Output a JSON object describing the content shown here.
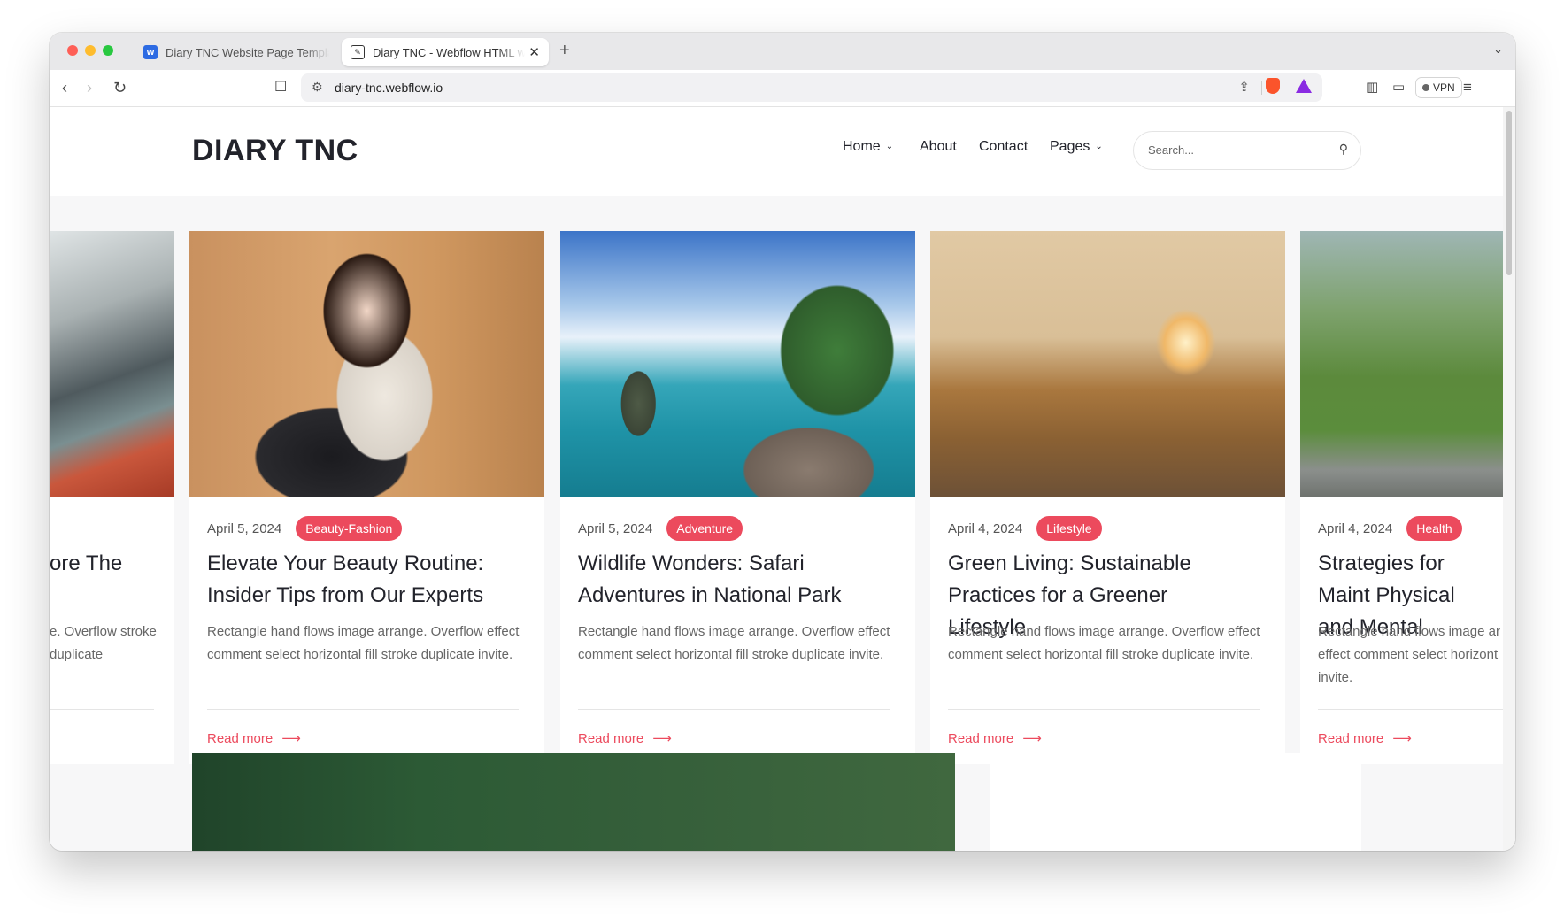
{
  "browser": {
    "tabs": [
      {
        "title": "Diary TNC Website Page Template",
        "active": false
      },
      {
        "title": "Diary TNC - Webflow HTML website template",
        "active": true
      }
    ],
    "new_tab_symbol": "+",
    "close_symbol": "✕",
    "url": "diary-tnc.webflow.io",
    "vpn_label": "VPN"
  },
  "site": {
    "logo": "DIARY TNC",
    "nav": [
      {
        "label": "Home",
        "has_dropdown": true
      },
      {
        "label": "About",
        "has_dropdown": false
      },
      {
        "label": "Contact",
        "has_dropdown": false
      },
      {
        "label": "Pages",
        "has_dropdown": true
      }
    ],
    "search_placeholder": "Search..."
  },
  "cards": [
    {
      "date": "",
      "tag": "",
      "title": "ore The",
      "excerpt": "e. Overflow stroke duplicate",
      "read_more": ""
    },
    {
      "date": "April 5, 2024",
      "tag": "Beauty-Fashion",
      "title": "Elevate Your Beauty Routine: Insider Tips from Our Experts",
      "excerpt": "Rectangle hand flows image arrange. Overflow effect comment select horizontal fill stroke duplicate invite.",
      "read_more": "Read more"
    },
    {
      "date": "April 5, 2024",
      "tag": "Adventure",
      "title": "Wildlife Wonders: Safari Adventures in National Park",
      "excerpt": "Rectangle hand flows image arrange. Overflow effect comment select horizontal fill stroke duplicate invite.",
      "read_more": "Read more"
    },
    {
      "date": "April 4, 2024",
      "tag": "Lifestyle",
      "title": "Green Living: Sustainable Practices for a Greener Lifestyle",
      "excerpt": "Rectangle hand flows image arrange. Overflow effect comment select horizontal fill stroke duplicate invite.",
      "read_more": "Read more"
    },
    {
      "date": "April 4, 2024",
      "tag": "Health",
      "title": "Strategies for Maint Physical and Mental",
      "excerpt": "Rectangle hand flows image ar effect comment select horizont invite.",
      "read_more": "Read more"
    }
  ],
  "colors": {
    "accent": "#ec4a5d",
    "heading": "#22232b",
    "page_bg": "#f7f7f8"
  }
}
